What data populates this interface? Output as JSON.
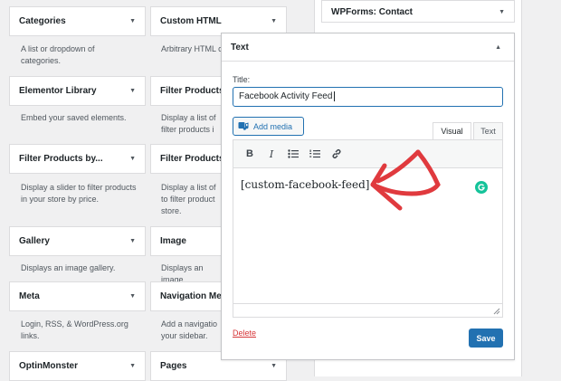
{
  "widgets": [
    {
      "name": "Categories",
      "desc": "A list or dropdown of categories."
    },
    {
      "name": "Custom HTML",
      "desc": "Arbitrary HTML code."
    },
    {
      "name": "Elementor Library",
      "desc": "Embed your saved elements."
    },
    {
      "name": "Filter Products",
      "desc": "Display a list of filter products i"
    },
    {
      "name": "Filter Products by...",
      "desc": "Display a slider to filter prod­ucts in your store by price."
    },
    {
      "name": "Filter Products",
      "desc": "Display a list of to filter product store."
    },
    {
      "name": "Gallery",
      "desc": "Displays an image gallery."
    },
    {
      "name": "Image",
      "desc": "Displays an image."
    },
    {
      "name": "Meta",
      "desc": "Login, RSS, & WordPress.org links."
    },
    {
      "name": "Navigation Me",
      "desc": "Add a navigatio your sidebar."
    },
    {
      "name": "OptinMonster",
      "desc": ""
    },
    {
      "name": "Pages",
      "desc": ""
    }
  ],
  "sidebar_area": {
    "title": "WPForms: Contact"
  },
  "text_widget": {
    "header": "Text",
    "title_label": "Title:",
    "title_value": "Facebook Activity Feed",
    "add_media_label": "Add media",
    "tab_visual": "Visual",
    "tab_text": "Text",
    "toolbar": {
      "bold": "B",
      "italic": "I"
    },
    "content": "[custom-facebook-feed]",
    "delete_label": "Delete",
    "save_label": "Save"
  },
  "colors": {
    "accent": "#2271b1",
    "danger": "#d63638",
    "annotation_arrow": "#e03a3e"
  }
}
